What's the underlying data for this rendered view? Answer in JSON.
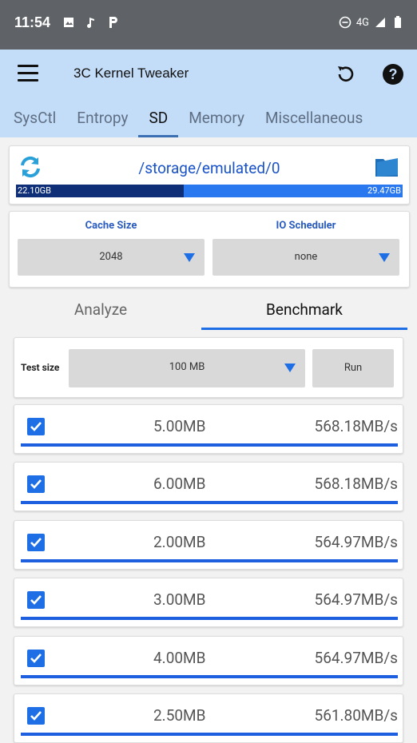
{
  "status": {
    "time": "11:54",
    "network": "4G"
  },
  "appbar": {
    "title": "3C Kernel Tweaker"
  },
  "tabs": [
    "SysCtl",
    "Entropy",
    "SD",
    "Memory",
    "Miscellaneous"
  ],
  "storage": {
    "path": "/storage/emulated/0",
    "used": "22.10GB",
    "total": "29.47GB",
    "used_fraction": 0.433
  },
  "settings": {
    "cache_label": "Cache Size",
    "cache_value": "2048",
    "io_label": "IO Scheduler",
    "io_value": "none"
  },
  "subtabs": {
    "analyze": "Analyze",
    "benchmark": "Benchmark"
  },
  "test": {
    "label": "Test size",
    "value": "100 MB",
    "run": "Run"
  },
  "results": [
    {
      "size": "5.00MB",
      "speed": "568.18MB/s"
    },
    {
      "size": "6.00MB",
      "speed": "568.18MB/s"
    },
    {
      "size": "2.00MB",
      "speed": "564.97MB/s"
    },
    {
      "size": "3.00MB",
      "speed": "564.97MB/s"
    },
    {
      "size": "4.00MB",
      "speed": "564.97MB/s"
    },
    {
      "size": "2.50MB",
      "speed": "561.80MB/s"
    }
  ],
  "colors": {
    "accent": "#1e6fe6",
    "appbar": "#c3dcf7",
    "statusbar": "#5f6368"
  }
}
